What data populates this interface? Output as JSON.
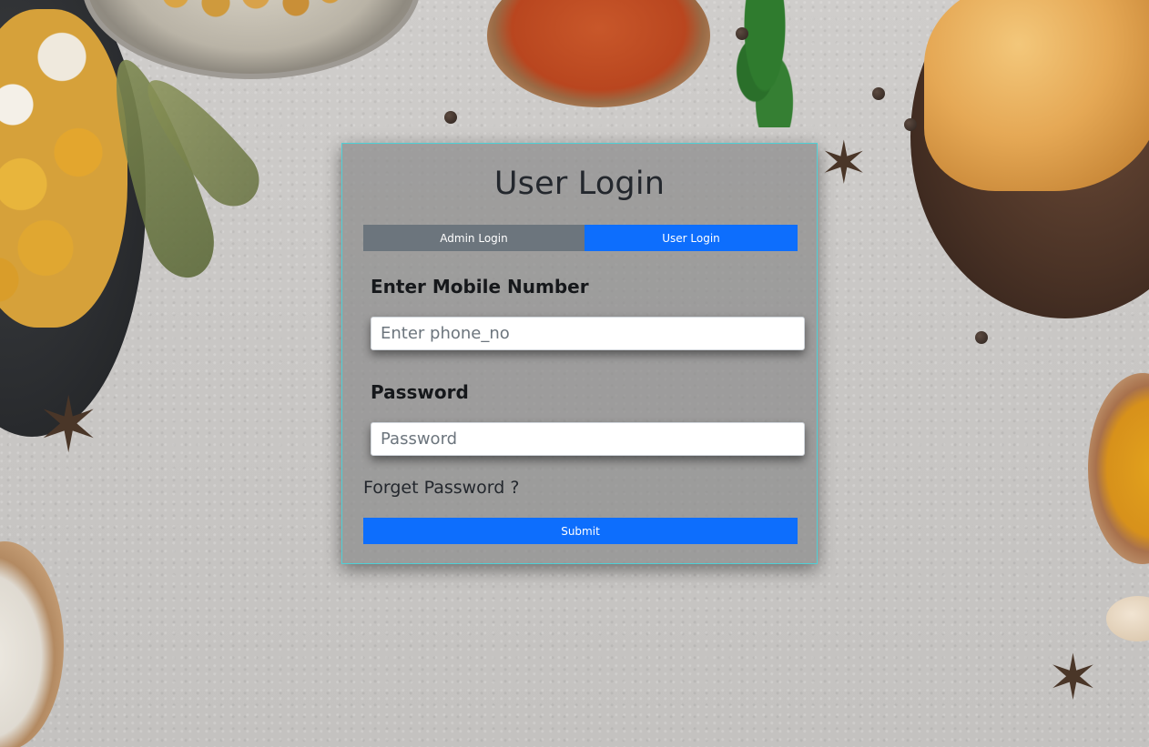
{
  "login": {
    "title": "User Login",
    "tabs": [
      {
        "label": "Admin Login",
        "active": false
      },
      {
        "label": "User Login",
        "active": true
      }
    ],
    "mobile_label": "Enter Mobile Number",
    "mobile_placeholder": "Enter phone_no",
    "mobile_value": "",
    "password_label": "Password",
    "password_placeholder": "Password",
    "password_value": "",
    "forget_link": "Forget Password ?",
    "submit_label": "Submit"
  },
  "colors": {
    "primary": "#0d6efd",
    "secondary": "#6c757d",
    "card_border": "#4fd0d6",
    "card_background": "rgba(140,140,140,0.72)"
  },
  "background": {
    "description_icons": [
      "food-plate-icon",
      "spice-bowl-icon",
      "star-anise-icon",
      "herb-leaf-icon"
    ]
  }
}
